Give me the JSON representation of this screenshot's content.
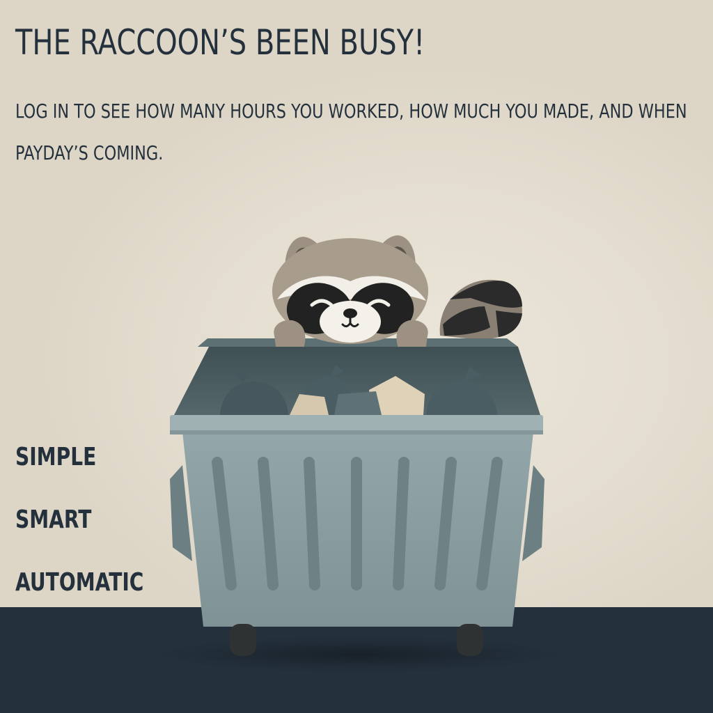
{
  "hero": {
    "headline": "The raccoon’s been busy!",
    "subtitle": "Log in to see how many hours you worked, how much you made, and when payday’s coming."
  },
  "features": [
    {
      "label": "Simple"
    },
    {
      "label": "Smart"
    },
    {
      "label": "Automatic"
    }
  ],
  "illustration": {
    "subject": "raccoon-in-dumpster",
    "colors": {
      "background": "#e3dcce",
      "floor": "#24313d",
      "dumpster": "#8a9ea1",
      "raccoon_fur": "#a89c8c",
      "raccoon_mask": "#222222"
    }
  }
}
